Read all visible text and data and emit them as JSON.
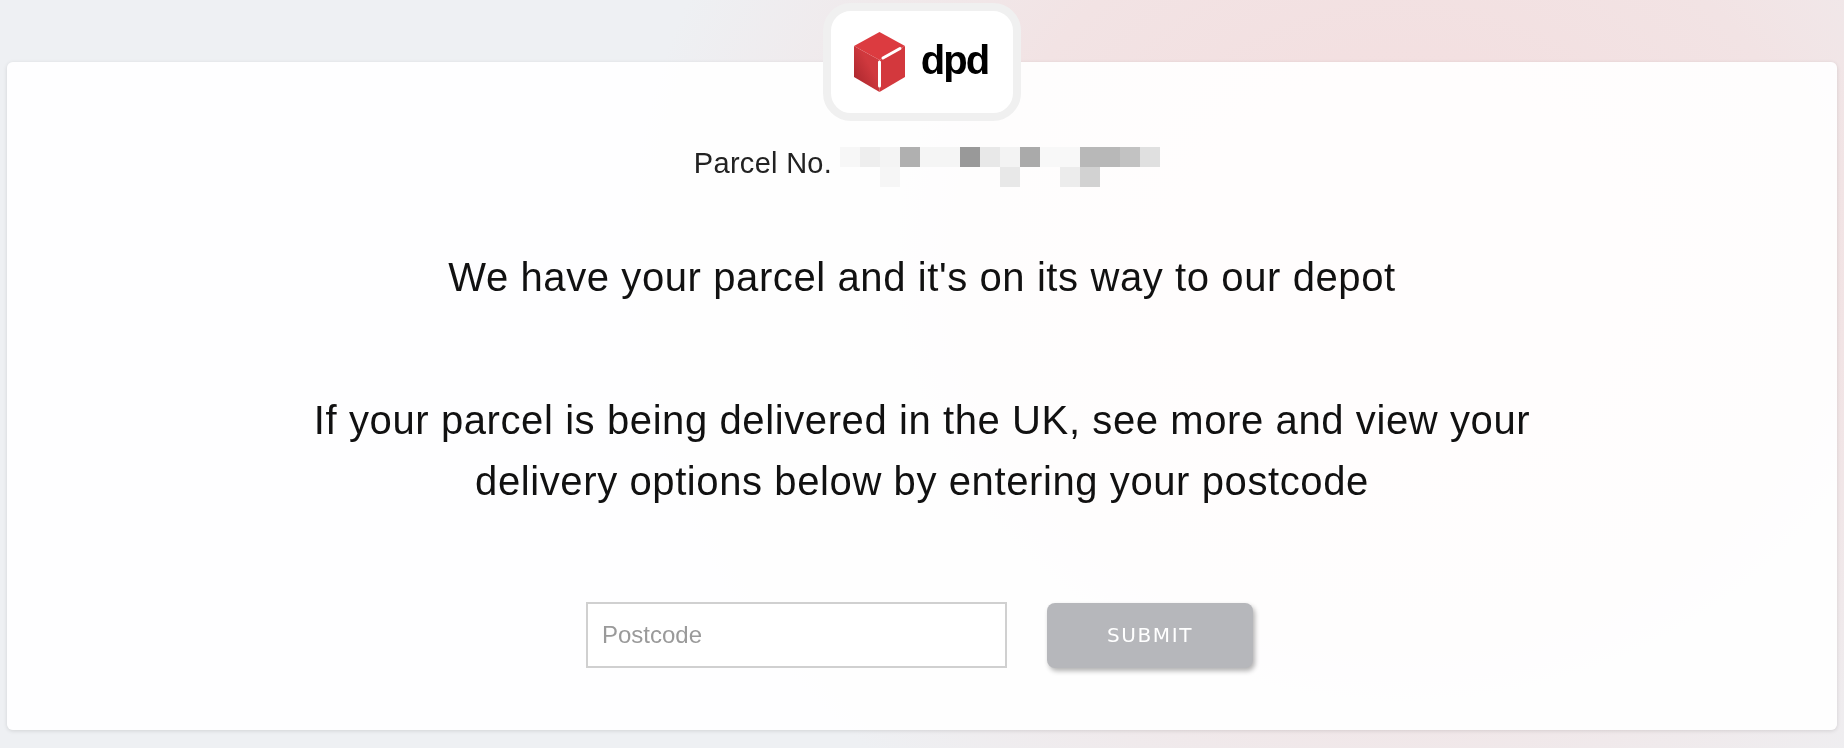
{
  "logo": {
    "wordmark": "dpd"
  },
  "parcel": {
    "label": "Parcel No."
  },
  "status": {
    "heading": "We have your parcel and it's on its way to our depot",
    "message": "If your parcel is being delivered in the UK, see more and view your delivery options below by entering your postcode"
  },
  "postcode_form": {
    "field": {
      "placeholder": "Postcode"
    },
    "submit": {
      "label": "SUBMIT",
      "disabled": true
    }
  }
}
